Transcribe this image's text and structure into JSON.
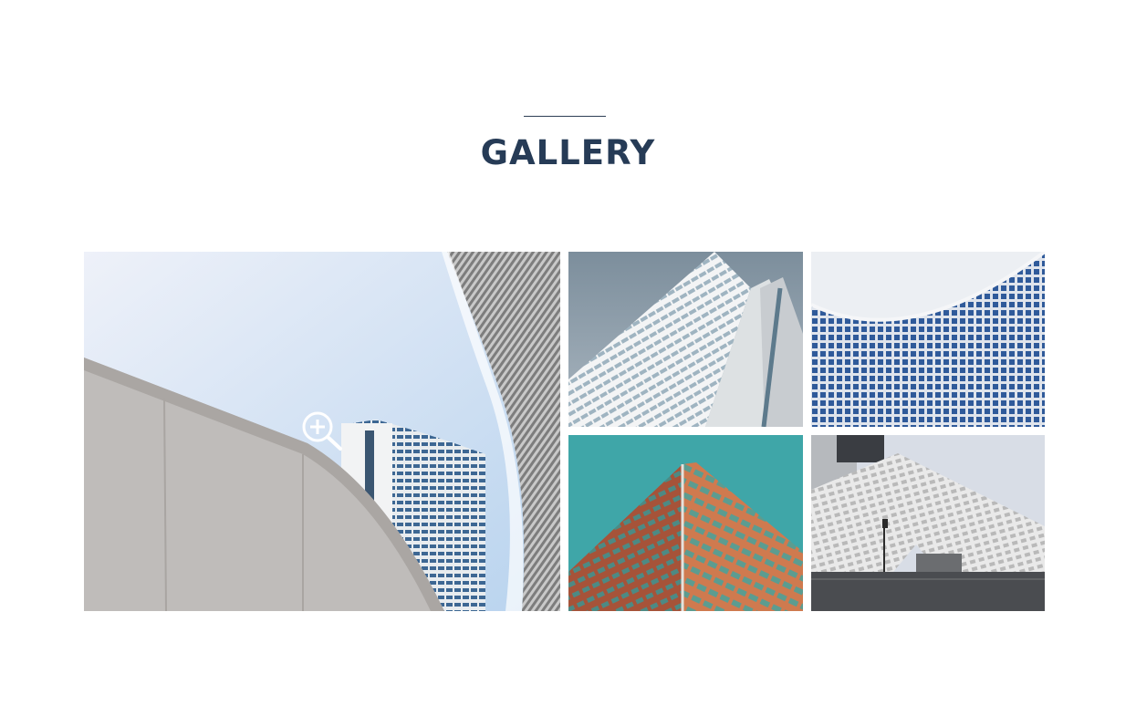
{
  "gallery": {
    "title": "GALLERY",
    "accent_color": "#263b56",
    "zoom_icon": "zoom-in-icon",
    "images": [
      {
        "name": "gallery-image-curved-tower-and-wall"
      },
      {
        "name": "gallery-image-white-skyscraper"
      },
      {
        "name": "gallery-image-curved-glass-facade"
      },
      {
        "name": "gallery-image-orange-building-teal-sky"
      },
      {
        "name": "gallery-image-white-honeycomb-museum"
      }
    ]
  }
}
